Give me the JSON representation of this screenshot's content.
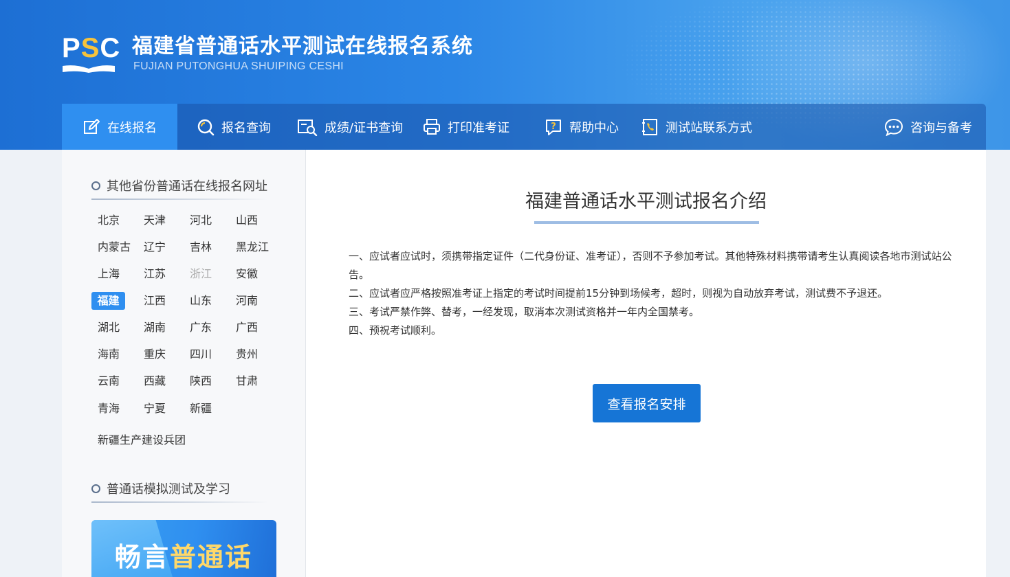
{
  "brand": {
    "logo_text": "PSC",
    "title": "福建省普通话水平测试在线报名系统",
    "subtitle": "FUJIAN PUTONGHUA SHUIPING CESHI",
    "accent_color": "#2f8ff0",
    "logo_accent": "#f7c33c"
  },
  "nav": {
    "items": [
      {
        "label": "在线报名",
        "icon": "edit-icon",
        "active": true
      },
      {
        "label": "报名查询",
        "icon": "search-icon"
      },
      {
        "label": "成绩/证书查询",
        "icon": "certificate-search-icon"
      },
      {
        "label": "打印准考证",
        "icon": "printer-icon"
      },
      {
        "label": "帮助中心",
        "icon": "help-icon"
      },
      {
        "label": "测试站联系方式",
        "icon": "phone-contact-icon"
      },
      {
        "label": "咨询与备考",
        "icon": "chat-icon"
      }
    ]
  },
  "sidebar": {
    "provinces_heading": "其他省份普通话在线报名网址",
    "provinces": [
      "北京",
      "天津",
      "河北",
      "山西",
      "内蒙古",
      "辽宁",
      "吉林",
      "黑龙江",
      "上海",
      "江苏",
      "浙江",
      "安徽",
      "福建",
      "江西",
      "山东",
      "河南",
      "湖北",
      "湖南",
      "广东",
      "广西",
      "海南",
      "重庆",
      "四川",
      "贵州",
      "云南",
      "西藏",
      "陕西",
      "甘肃",
      "青海",
      "宁夏",
      "新疆"
    ],
    "selected_province": "福建",
    "disabled_province": "浙江",
    "extra_province": "新疆生产建设兵团",
    "study_heading": "普通话模拟测试及学习",
    "promo_text_a": "畅言",
    "promo_text_b": "普通话"
  },
  "main": {
    "title": "福建普通话水平测试报名介绍",
    "notices": [
      "一、应试者应试时，须携带指定证件（二代身份证、准考证），否则不予参加考试。其他特殊材料携带请考生认真阅读各地市测试站公告。",
      "二、应试者应严格按照准考证上指定的考试时间提前15分钟到场候考，超时，则视为自动放弃考试，测试费不予退还。",
      "三、考试严禁作弊、替考，一经发现，取消本次测试资格并一年内全国禁考。",
      "四、预祝考试顺利。"
    ],
    "button_label": "查看报名安排"
  }
}
